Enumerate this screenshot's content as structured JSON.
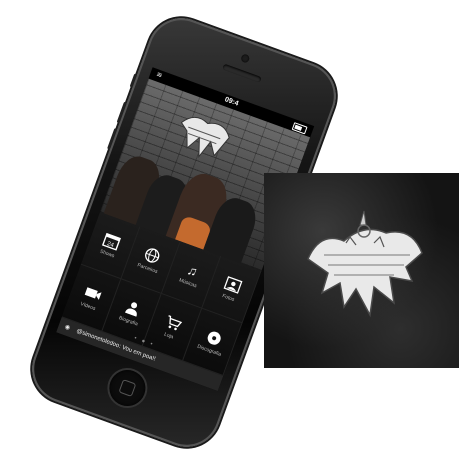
{
  "status_bar": {
    "time": "09:4"
  },
  "menu": [
    {
      "label": "Shows",
      "icon": "calendar-icon"
    },
    {
      "label": "Parceiros",
      "icon": "globe-icon"
    },
    {
      "label": "Músicas",
      "icon": "music-note-icon"
    },
    {
      "label": "Fotos",
      "icon": "photo-icon"
    },
    {
      "label": "Vídeos",
      "icon": "video-camera-icon"
    },
    {
      "label": "Biografia",
      "icon": "person-icon"
    },
    {
      "label": "Loja",
      "icon": "shopping-cart-icon"
    },
    {
      "label": "Discografia",
      "icon": "disc-icon"
    }
  ],
  "ticker": {
    "handle": "@simonetoledoo:",
    "text": "Vou em poa!!"
  },
  "colors": {
    "phone_body": "#0b0b0b",
    "screen_bg": "#0f0f0f",
    "shirt": "#c46a2e",
    "album_bg": "#141414"
  }
}
